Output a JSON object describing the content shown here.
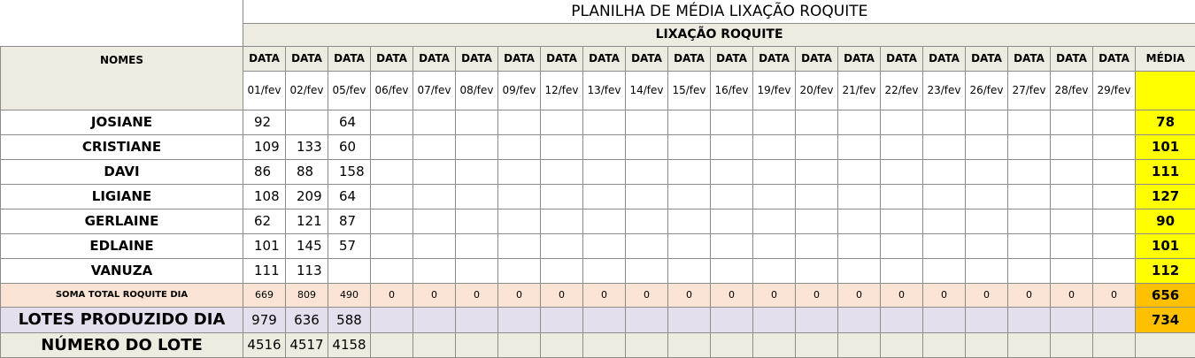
{
  "title": "PLANILHA DE MÉDIA LIXAÇÃO ROQUITE",
  "subtitle": "LIXAÇÃO ROQUITE",
  "header": {
    "names": "NOMES",
    "date": "DATA",
    "average": "MÉDIA"
  },
  "dates": [
    "01/fev",
    "02/fev",
    "05/fev",
    "06/fev",
    "07/fev",
    "08/fev",
    "09/fev",
    "12/fev",
    "13/fev",
    "14/fev",
    "15/fev",
    "16/fev",
    "19/fev",
    "20/fev",
    "21/fev",
    "22/fev",
    "23/fev",
    "26/fev",
    "27/fev",
    "28/fev",
    "29/fev"
  ],
  "rows": [
    {
      "name": "JOSIANE",
      "values": [
        "92",
        "",
        "64"
      ],
      "avg": "78"
    },
    {
      "name": "CRISTIANE",
      "values": [
        "109",
        "133",
        "60"
      ],
      "avg": "101"
    },
    {
      "name": "DAVI",
      "values": [
        "86",
        "88",
        "158"
      ],
      "avg": "111"
    },
    {
      "name": "LIGIANE",
      "values": [
        "108",
        "209",
        "64"
      ],
      "avg": "127"
    },
    {
      "name": "GERLAINE",
      "values": [
        "62",
        "121",
        "87"
      ],
      "avg": "90"
    },
    {
      "name": "EDLAINE",
      "values": [
        "101",
        "145",
        "57"
      ],
      "avg": "101"
    },
    {
      "name": "VANUZA",
      "values": [
        "111",
        "113",
        ""
      ],
      "avg": "112"
    }
  ],
  "sum": {
    "label": "SOMA TOTAL  ROQUITE DIA",
    "values": [
      "669",
      "809",
      "490",
      "0",
      "0",
      "0",
      "0",
      "0",
      "0",
      "0",
      "0",
      "0",
      "0",
      "0",
      "0",
      "0",
      "0",
      "0",
      "0",
      "0",
      "0"
    ],
    "avg": "656"
  },
  "lots": {
    "label": "LOTES PRODUZIDO DIA",
    "values": [
      "979",
      "636",
      "588"
    ],
    "avg": "734"
  },
  "lot_number": {
    "label": "NÚMERO DO LOTE",
    "values": [
      "4516",
      "4517",
      "4158"
    ]
  },
  "colors": {
    "header_bg": "#eeece1",
    "avg_bg": "#ffff00",
    "sum_bg": "#fbe4d5",
    "lots_bg": "#e4dfec",
    "avg_total_bg": "#ffc000"
  }
}
